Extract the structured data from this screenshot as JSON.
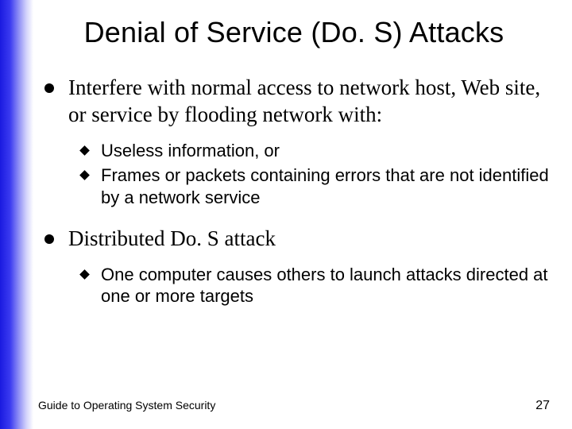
{
  "title": "Denial of Service (Do. S) Attacks",
  "bullets": [
    {
      "text": "Interfere with normal access to network host, Web site, or service by flooding network with:",
      "sub": [
        "Useless information, or",
        "Frames or packets containing errors that are not identified by a network service"
      ]
    },
    {
      "text": "Distributed Do. S attack",
      "sub": [
        "One computer causes others to launch attacks directed at one or more targets"
      ]
    }
  ],
  "footer": {
    "source": "Guide to Operating System Security",
    "page": "27"
  }
}
